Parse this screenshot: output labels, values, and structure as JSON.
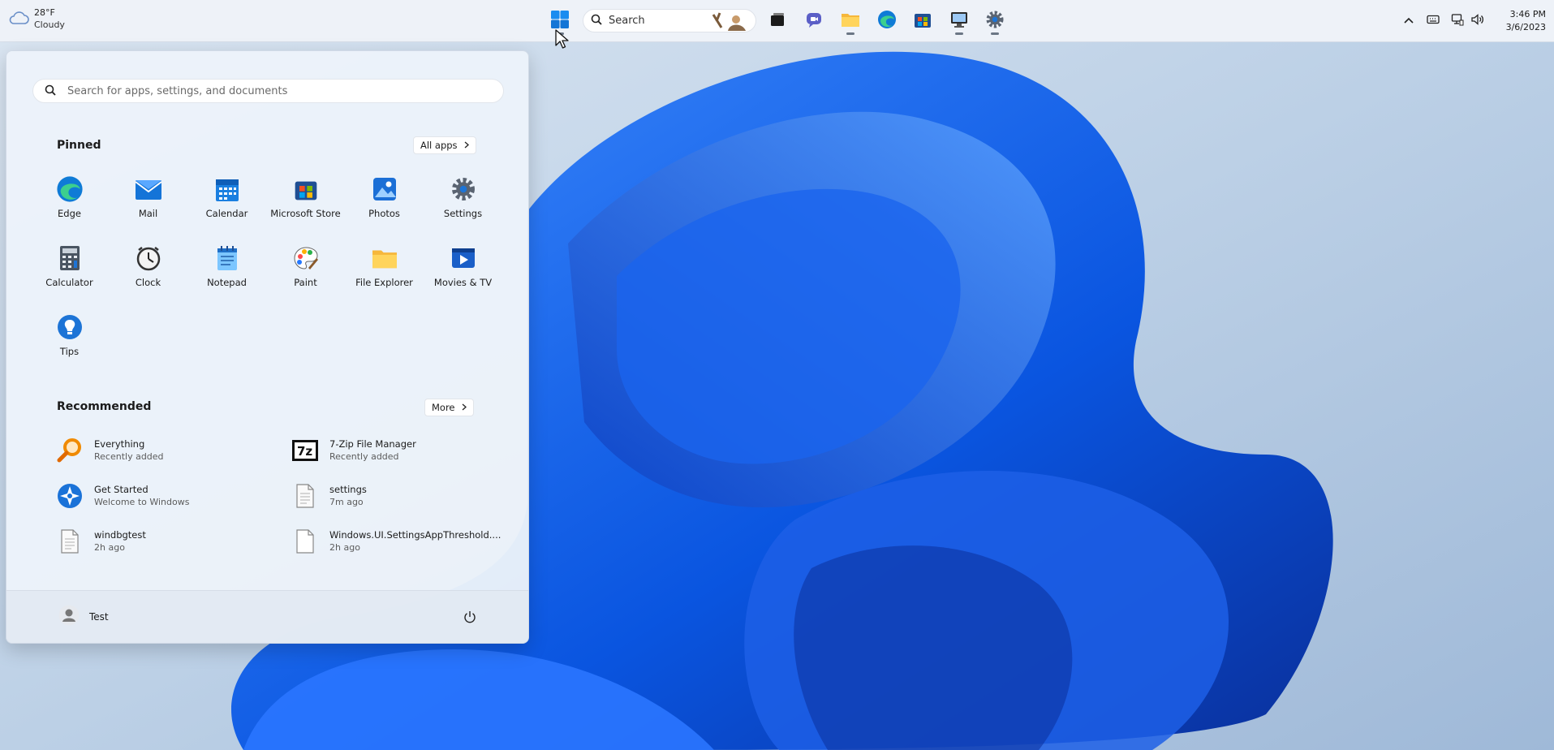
{
  "weather": {
    "temp": "28°F",
    "condition": "Cloudy",
    "icon": "cloud-icon"
  },
  "taskbar": {
    "search_label": "Search",
    "apps": [
      {
        "name": "start",
        "icon": "windows-logo-icon"
      },
      {
        "name": "task-view",
        "icon": "task-view-icon"
      },
      {
        "name": "chat",
        "icon": "chat-icon"
      },
      {
        "name": "file-explorer",
        "icon": "folder-icon"
      },
      {
        "name": "edge",
        "icon": "edge-icon"
      },
      {
        "name": "store",
        "icon": "store-icon"
      },
      {
        "name": "remote-desktop",
        "icon": "monitor-icon"
      },
      {
        "name": "settings",
        "icon": "gear-icon"
      }
    ]
  },
  "clock": {
    "time": "3:46 PM",
    "date": "3/6/2023"
  },
  "start_menu": {
    "search_placeholder": "Search for apps, settings, and documents",
    "pinned_title": "Pinned",
    "all_apps_label": "All apps",
    "pinned": [
      {
        "label": "Edge",
        "icon": "edge-icon"
      },
      {
        "label": "Mail",
        "icon": "mail-icon"
      },
      {
        "label": "Calendar",
        "icon": "calendar-icon"
      },
      {
        "label": "Microsoft Store",
        "icon": "store-icon"
      },
      {
        "label": "Photos",
        "icon": "photos-icon"
      },
      {
        "label": "Settings",
        "icon": "gear-icon"
      },
      {
        "label": "Calculator",
        "icon": "calculator-icon"
      },
      {
        "label": "Clock",
        "icon": "clock-icon"
      },
      {
        "label": "Notepad",
        "icon": "notepad-icon"
      },
      {
        "label": "Paint",
        "icon": "paint-icon"
      },
      {
        "label": "File Explorer",
        "icon": "folder-icon"
      },
      {
        "label": "Movies & TV",
        "icon": "movies-icon"
      },
      {
        "label": "Tips",
        "icon": "tips-icon"
      }
    ],
    "recommended_title": "Recommended",
    "more_label": "More",
    "recommended": [
      {
        "title": "Everything",
        "subtitle": "Recently added",
        "icon": "everything-search-icon"
      },
      {
        "title": "7-Zip File Manager",
        "subtitle": "Recently added",
        "icon": "7zip-icon"
      },
      {
        "title": "Get Started",
        "subtitle": "Welcome to Windows",
        "icon": "get-started-icon"
      },
      {
        "title": "settings",
        "subtitle": "7m ago",
        "icon": "document-icon"
      },
      {
        "title": "windbgtest",
        "subtitle": "2h ago",
        "icon": "document-icon"
      },
      {
        "title": "Windows.UI.SettingsAppThreshold....",
        "subtitle": "2h ago",
        "icon": "document-icon"
      }
    ],
    "user_name": "Test"
  }
}
